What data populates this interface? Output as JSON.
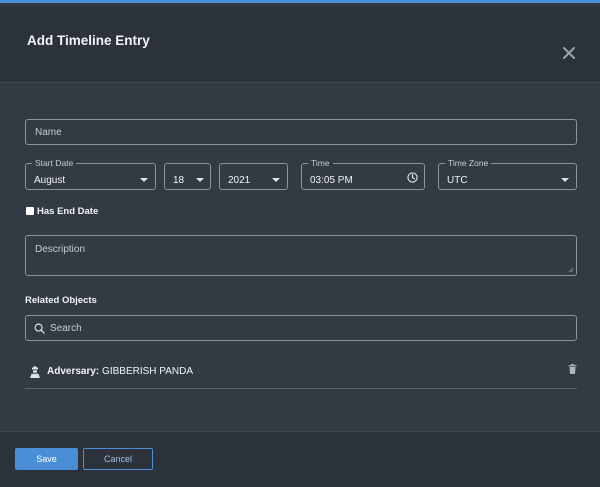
{
  "dialog": {
    "title": "Add Timeline Entry",
    "close_icon": "close-icon"
  },
  "form": {
    "name_placeholder": "Name",
    "start_date_label": "Start Date",
    "start_month": "August",
    "start_day": "18",
    "start_year": "2021",
    "time_label": "Time",
    "time_value": "03:05 PM",
    "timezone_label": "Time Zone",
    "timezone_value": "UTC",
    "has_end_date_label": "Has End Date",
    "has_end_date_checked": false,
    "description_placeholder": "Description"
  },
  "related": {
    "label": "Related Objects",
    "search_placeholder": "Search",
    "objects": [
      {
        "type": "Adversary:",
        "name": "GIBBERISH PANDA",
        "icon": "adversary-icon"
      }
    ]
  },
  "footer": {
    "save_label": "Save",
    "cancel_label": "Cancel"
  },
  "colors": {
    "accent": "#4a8fd6",
    "background": "#323a44",
    "header": "#2b323b"
  }
}
